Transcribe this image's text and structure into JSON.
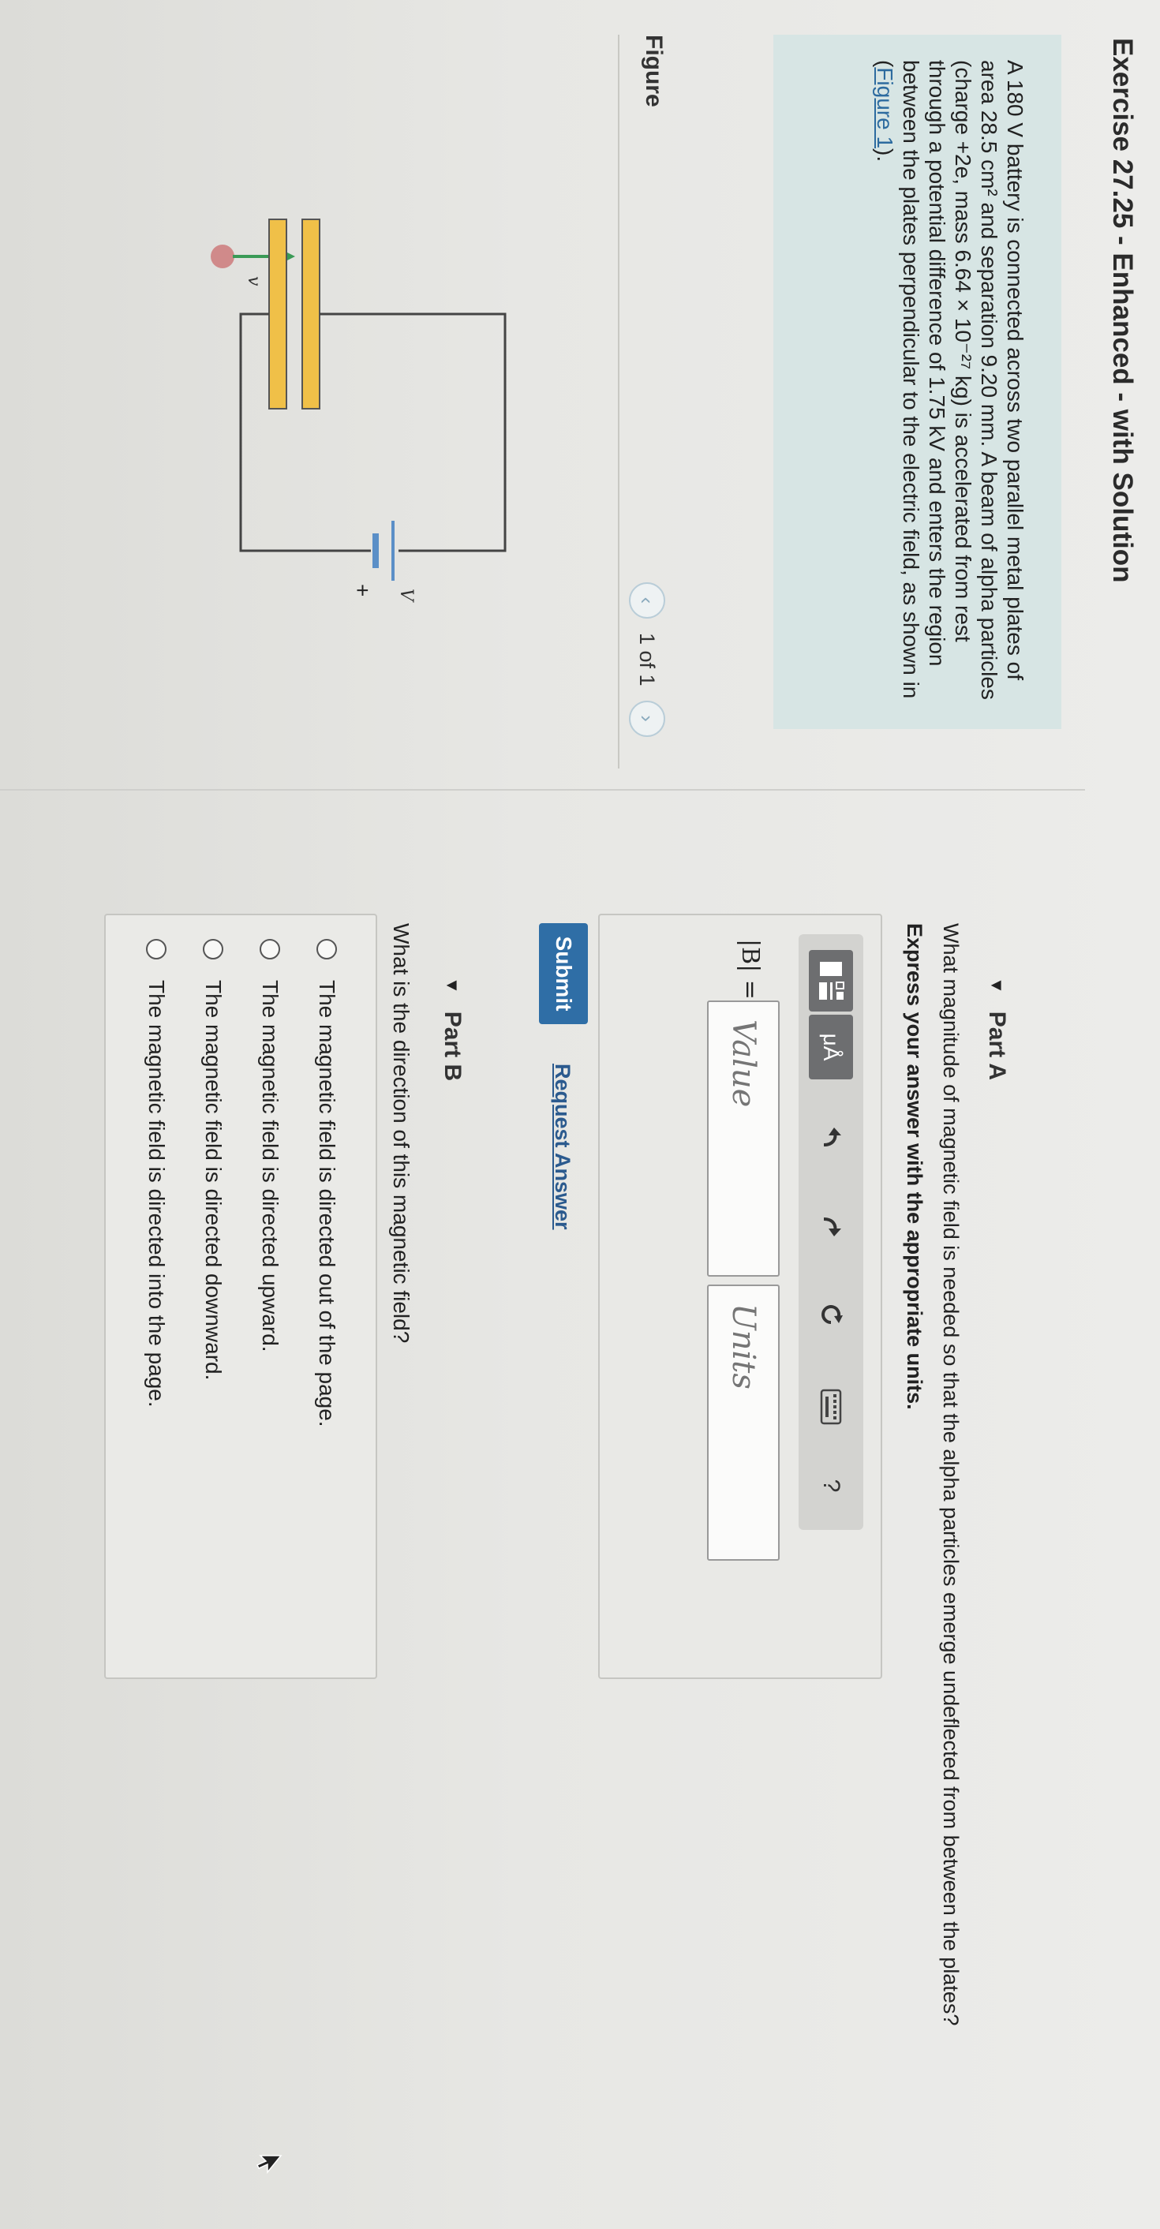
{
  "header": {
    "title": "Exercise 27.25 - Enhanced - with Solution"
  },
  "problem": {
    "text_before_link": "A 180 V battery is connected across two parallel metal plates of area 28.5 cm² and separation 9.20 mm. A beam of alpha particles (charge +2e, mass 6.64 × 10⁻²⁷ kg) is accelerated from rest through a potential difference of 1.75 kV and enters the region between the plates perpendicular to the electric field, as shown in (",
    "link_text": "Figure 1",
    "text_after_link": ")."
  },
  "figure": {
    "label": "Figure",
    "pager_text": "1 of 1",
    "prev_icon": "chevron-left-icon",
    "next_icon": "chevron-right-icon",
    "circuit_labels": {
      "velocity": "v",
      "battery": "V",
      "plus": "+"
    },
    "colors": {
      "plates": "#f0c048",
      "plate_border": "#555555",
      "particle": "#d08a8a",
      "velocity_arrow": "#3a9a56",
      "battery_short": "#5b8fc7"
    }
  },
  "partA": {
    "label": "Part A",
    "question": "What magnitude of magnetic field is needed so that the alpha particles emerge undeflected from between the plates?",
    "instruction": "Express your answer with the appropriate units.",
    "toolbar": {
      "units_label": "μÅ",
      "help_label": "?",
      "icons": [
        "templates-icon",
        "units-icon",
        "undo-icon",
        "redo-icon",
        "reset-icon",
        "keyboard-icon",
        "help-icon"
      ]
    },
    "answer_label": "|B| =",
    "value_placeholder": "Value",
    "units_placeholder": "Units",
    "submit_label": "Submit",
    "request_answer_label": "Request Answer"
  },
  "partB": {
    "label": "Part B",
    "question": "What is the direction of this magnetic field?",
    "options": [
      "The magnetic field is directed out of the page.",
      "The magnetic field is directed upward.",
      "The magnetic field is directed downward.",
      "The magnetic field is directed into the page."
    ]
  },
  "colors": {
    "accent": "#2f6ea6",
    "problem_bg": "#d7e5e4",
    "link": "#2d6b9f"
  }
}
